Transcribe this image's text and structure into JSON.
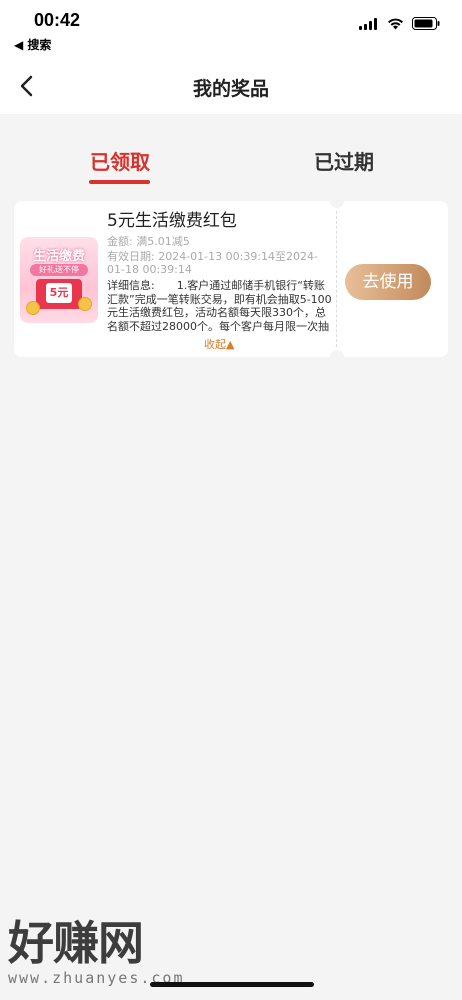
{
  "status_bar": {
    "time": "00:42",
    "back_app": "◀ 搜索"
  },
  "nav": {
    "title": "我的奖品"
  },
  "tabs": [
    {
      "label": "已领取"
    },
    {
      "label": "已过期"
    }
  ],
  "prize": {
    "thumb_title": "生活缴费",
    "thumb_sub": "好礼送不停",
    "thumb_amount": "5元",
    "title": "5元生活缴费红包",
    "amount": "金额: 满5.01减5",
    "valid": "有效日期: 2024-01-13 00:39:14至2024-01-18 00:39:14",
    "detail": "详细信息:　　1.客户通过邮储手机银行“转账汇款”完成一笔转账交易，即有机会抽取5-100元生活缴费红包，活动名额每天限330个，总名额不超过28000个。每个客户每月限一次抽奖机会，先到先得，抽完为止。",
    "collapse_label": "收起▲",
    "use_button": "去使用"
  },
  "watermark": {
    "text": "好赚网",
    "url": "www.zhuanyes.com"
  },
  "colors": {
    "accent": "#d9322c",
    "use_button": "#c9935f",
    "collapse": "#e07b28"
  }
}
